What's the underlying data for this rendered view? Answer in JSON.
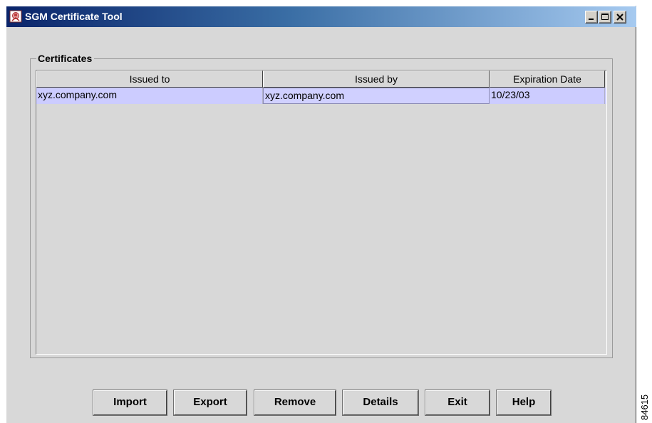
{
  "window": {
    "title": "SGM Certificate Tool",
    "controls": {
      "minimize": "minimize-icon",
      "maximize": "maximize-icon",
      "close": "close-icon"
    }
  },
  "certificates": {
    "group_label": "Certificates",
    "columns": [
      "Issued to",
      "Issued by",
      "Expiration Date"
    ],
    "rows": [
      {
        "issued_to": "xyz.company.com",
        "issued_by": "xyz.company.com",
        "expiration": "10/23/03"
      }
    ]
  },
  "buttons": {
    "import": "Import",
    "export": "Export",
    "remove": "Remove",
    "details": "Details",
    "exit": "Exit",
    "help": "Help"
  },
  "figure_id": "84615",
  "colors": {
    "titlebar_start": "#0a246a",
    "titlebar_end": "#a6caf0",
    "selection": "#ccccff",
    "window_bg": "#d8d8d8"
  }
}
